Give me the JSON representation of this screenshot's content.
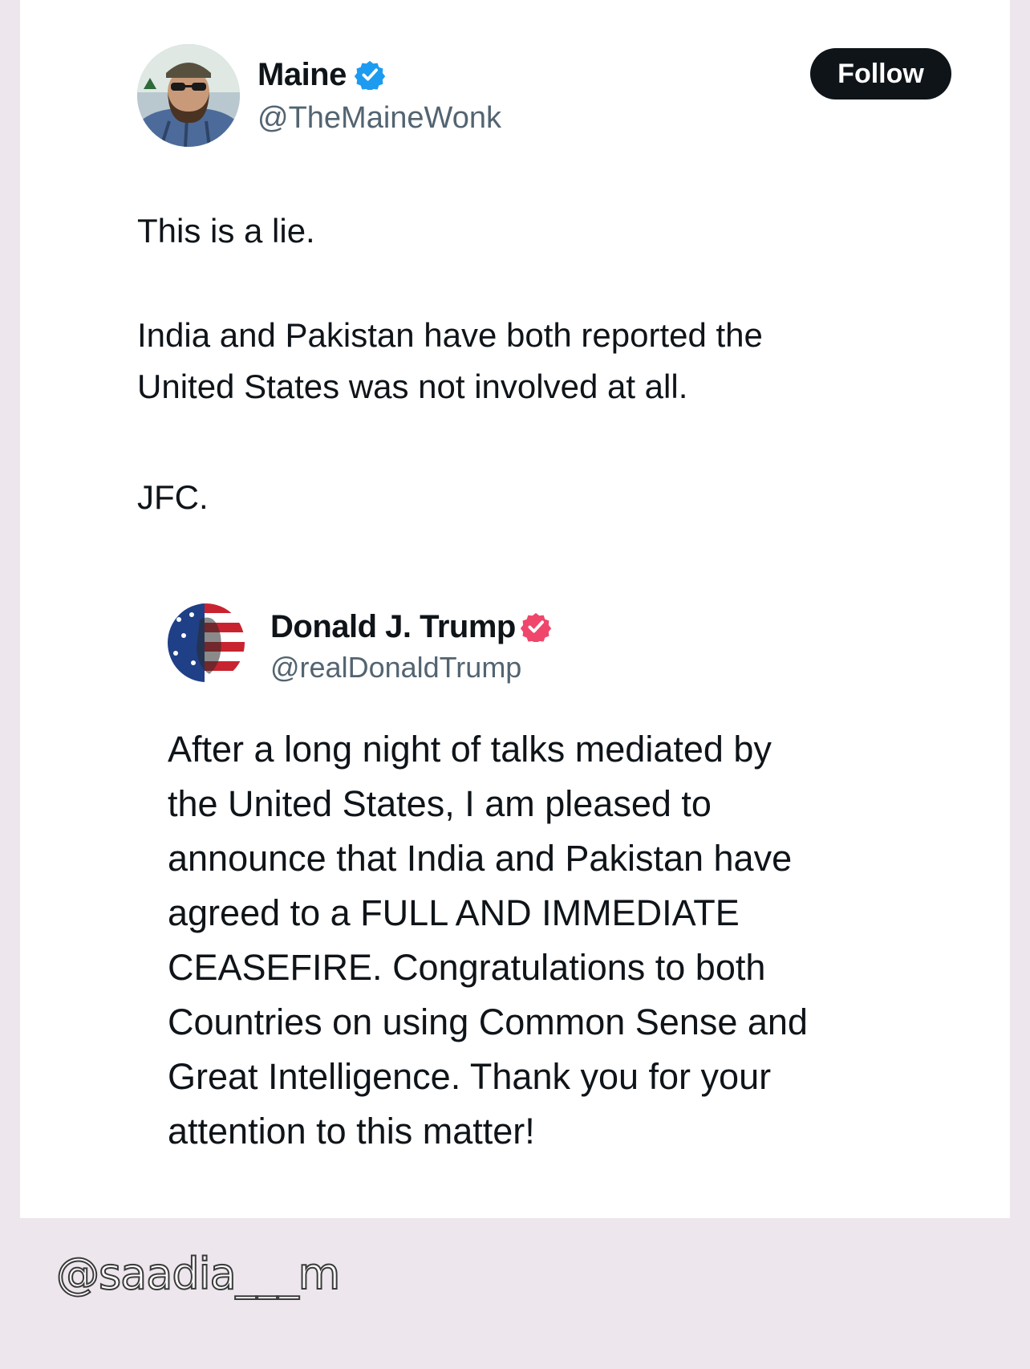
{
  "post": {
    "author": {
      "name": "Maine",
      "handle": "@TheMaineWonk",
      "verified_badge_color": "#1d9bf0",
      "avatar_icon": "user-avatar-photo"
    },
    "follow_label": "Follow",
    "text": {
      "line1": "This is a lie.",
      "line2": "India and Pakistan have both reported the",
      "line3": "United States was not involved at all.",
      "line4": "JFC."
    }
  },
  "quoted_post": {
    "author": {
      "name": "Donald J. Trump",
      "handle": "@realDonaldTrump",
      "verified_badge_color": "#f0466b",
      "avatar_icon": "flag-portrait-avatar"
    },
    "lines": [
      "After a long night of talks mediated by",
      "the United States, I am pleased to",
      "announce that India and Pakistan have",
      "agreed to a FULL AND IMMEDIATE",
      "CEASEFIRE. Congratulations to both",
      "Countries on using Common Sense and",
      "Great Intelligence. Thank you for your",
      "attention to this matter!"
    ]
  },
  "watermark": "@saadia___m"
}
